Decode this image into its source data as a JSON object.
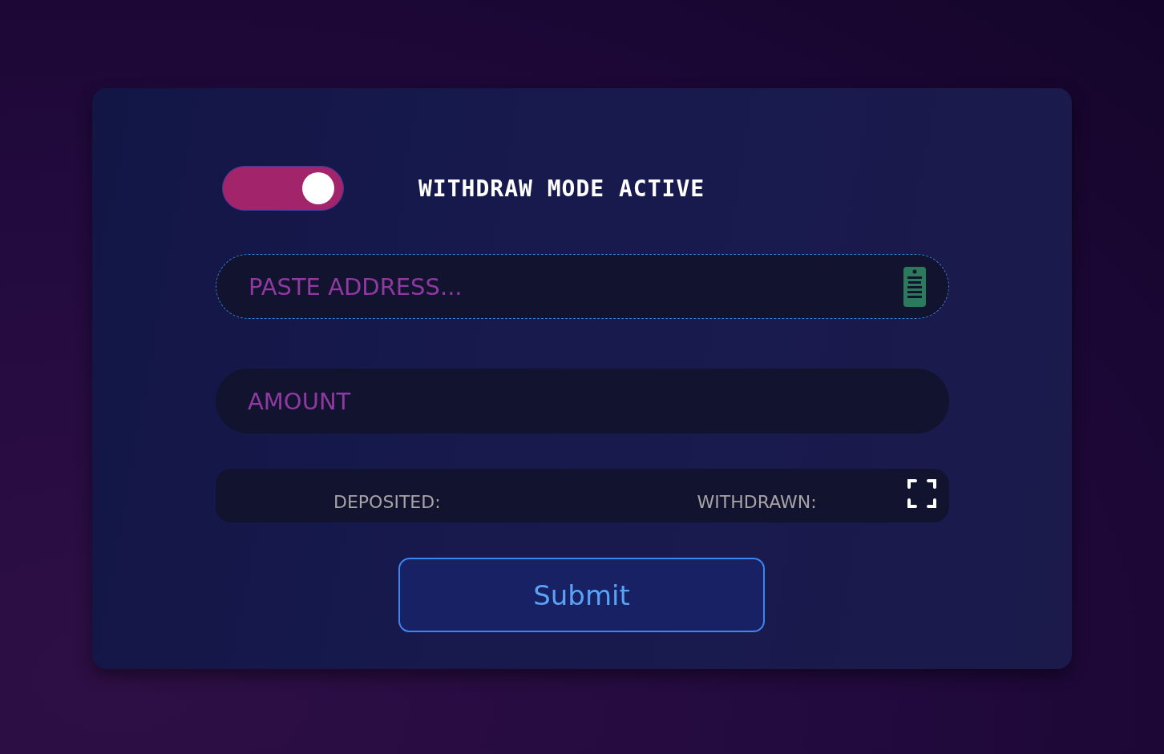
{
  "mode_toggle": {
    "on": true,
    "label": "WITHDRAW MODE ACTIVE"
  },
  "address_field": {
    "placeholder": "PASTE ADDRESS..."
  },
  "amount_field": {
    "placeholder": "AMOUNT"
  },
  "stats": [
    {
      "label": "DEPOSITED:"
    },
    {
      "label": "WITHDRAWN:"
    }
  ],
  "submit_button": {
    "label": "Submit"
  }
}
